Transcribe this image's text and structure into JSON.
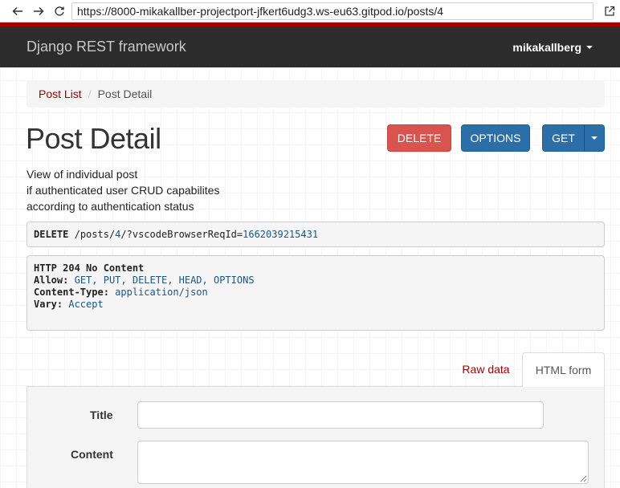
{
  "browser": {
    "url": "https://8000-mikakallber-projectport-jfkert6udg3.ws-eu63.gitpod.io/posts/4"
  },
  "navbar": {
    "brand": "Django REST framework",
    "user": "mikakallberg"
  },
  "breadcrumb": {
    "items": [
      {
        "label": "Post List"
      },
      {
        "label": "Post Detail"
      }
    ],
    "separator": "/"
  },
  "page": {
    "title": "Post Detail",
    "description_lines": [
      "View of individual post",
      "if authenticated user CRUD capabilites",
      "according to authentication status"
    ]
  },
  "actions": {
    "delete_label": "DELETE",
    "options_label": "OPTIONS",
    "get_label": "GET"
  },
  "request": {
    "method": "DELETE",
    "path_prefix": "/posts/",
    "path_id": "4",
    "path_mid": "/?vscodeBrowserReqId=",
    "req_id": "1662039215431"
  },
  "response": {
    "status": "HTTP 204 No Content",
    "allow_key": "Allow:",
    "allow_value": "GET, PUT, DELETE, HEAD, OPTIONS",
    "content_type_key": "Content-Type:",
    "content_type_value": "application/json",
    "vary_key": "Vary:",
    "vary_value": "Accept"
  },
  "tabs": {
    "raw_label": "Raw data",
    "html_label": "HTML form"
  },
  "form": {
    "title_label": "Title",
    "title_value": "",
    "content_label": "Content",
    "content_value": ""
  },
  "colors": {
    "accent": "#a30000",
    "navbar_bg": "#2c2c2c",
    "delete_btn": "#d9534f",
    "primary_btn": "#2c6fa8"
  },
  "icons": {
    "back": "arrow-left-icon",
    "forward": "arrow-right-icon",
    "reload": "reload-icon",
    "open_external": "open-external-icon",
    "user_caret": "chevron-down-icon",
    "get_caret": "chevron-down-icon"
  }
}
